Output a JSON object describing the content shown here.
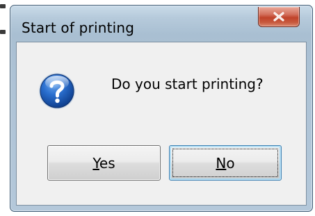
{
  "dialog": {
    "title": "Start of printing",
    "message": "Do you start printing?",
    "icon": "question-icon",
    "close_icon": "close-icon"
  },
  "buttons": {
    "yes": {
      "mnemonic": "Y",
      "rest": "es"
    },
    "no": {
      "mnemonic": "N",
      "rest": "o"
    }
  },
  "colors": {
    "close_button": "#c8452c",
    "icon_blue": "#1f5fb5",
    "client_bg": "#f0f0f0",
    "default_button_border": "#3c7fb1"
  }
}
